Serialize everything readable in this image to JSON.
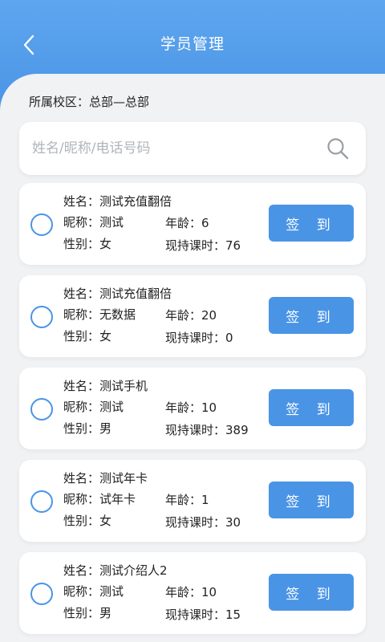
{
  "header": {
    "title": "学员管理"
  },
  "campus": "所属校区：总部—总部",
  "search": {
    "placeholder": "姓名/昵称/电话号码"
  },
  "labels": {
    "name": "姓名：",
    "nickname": "昵称：",
    "gender": "性别：",
    "age": "年龄：",
    "hours": "现持课时：",
    "signin": "签 到"
  },
  "students": [
    {
      "name": "测试充值翻倍",
      "nickname": "测试",
      "gender": "女",
      "age": "6",
      "hours": "76"
    },
    {
      "name": "测试充值翻倍",
      "nickname": "无数据",
      "gender": "女",
      "age": "20",
      "hours": "0"
    },
    {
      "name": "测试手机",
      "nickname": "测试",
      "gender": "男",
      "age": "10",
      "hours": "389"
    },
    {
      "name": "测试年卡",
      "nickname": "试年卡",
      "gender": "女",
      "age": "1",
      "hours": "30"
    },
    {
      "name": "测试介绍人2",
      "nickname": "测试",
      "gender": "男",
      "age": "10",
      "hours": "15"
    }
  ],
  "colors": {
    "accent": "#4a94e6",
    "header": "#5ea6ee",
    "background": "#f1f2f4"
  },
  "icons": {
    "back": "chevron-left-icon",
    "search": "search-icon",
    "select": "radio-icon"
  }
}
